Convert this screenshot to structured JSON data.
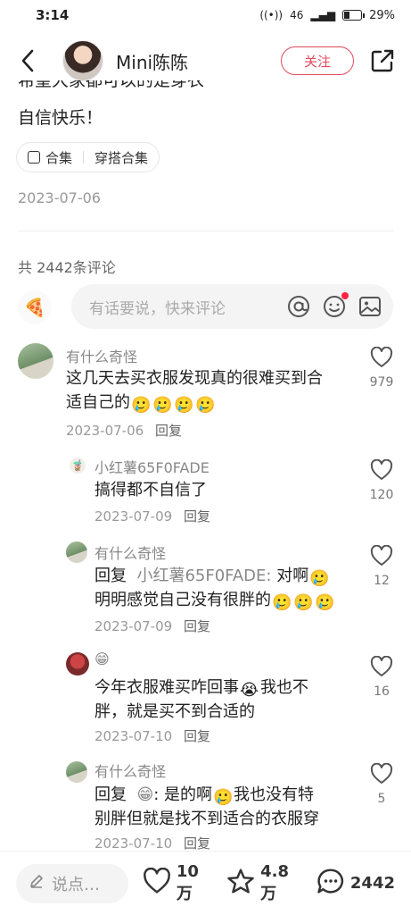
{
  "status_bar": {
    "time": "3:14",
    "network": "46",
    "battery": "29%"
  },
  "header": {
    "author": "Mini陈陈",
    "follow_label": "关注"
  },
  "post": {
    "line_cut": "希望大家都可以的是穿衣",
    "line_last": "自信快乐！",
    "tags": [
      "合集",
      "穿搭合集"
    ],
    "date": "2023-07-06"
  },
  "comments_header": {
    "count_text": "共 2442条评论"
  },
  "comment_input": {
    "placeholder": "有话要说，快来评论"
  },
  "comments": [
    {
      "user": "有什么奇怪",
      "text": "这几天去买衣服发现真的很难买到合",
      "text2": "适自己的",
      "date": "2023-07-06",
      "reply": "回复",
      "likes": "979"
    },
    {
      "user": "小红薯65F0FADE",
      "text": "搞得都不自信了",
      "date": "2023-07-09",
      "reply": "回复",
      "likes": "120"
    },
    {
      "user": "有什么奇怪",
      "reply_prefix": "回复",
      "reply_to": "小红薯65F0FADE:",
      "text": " 对啊",
      "text2": "明明感觉自己没有很胖的",
      "date": "2023-07-09",
      "reply": "回复",
      "likes": "12"
    },
    {
      "user": "😁",
      "text": "今年衣服难买咋回事",
      "text_b": "我也不",
      "text2": "胖，就是买不到合适的",
      "date": "2023-07-10",
      "reply": "回复",
      "likes": "16"
    },
    {
      "user": "有什么奇怪",
      "reply_prefix": "回复",
      "reply_to": "😁",
      "text": ": 是的啊",
      "text_b": "我也没有特",
      "text2": "别胖但就是找不到适合的衣服穿",
      "date": "2023-07-10",
      "reply": "回复",
      "likes": "5"
    }
  ],
  "bottom_bar": {
    "say_placeholder": "说点…",
    "likes": "10万",
    "collects": "4.8万",
    "comments": "2442"
  },
  "colors": {
    "accent": "#e04a5a",
    "notification": "#ff2442"
  }
}
